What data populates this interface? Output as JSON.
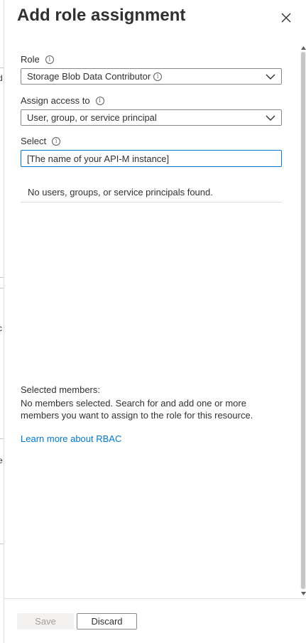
{
  "blade": {
    "title": "Add role assignment",
    "close_icon": "close-icon"
  },
  "form": {
    "role": {
      "label": "Role",
      "value": "Storage Blob Data Contributor",
      "info_icon": "info-icon",
      "value_info_icon": "info-icon",
      "chevron_icon": "chevron-down-icon"
    },
    "assign_access": {
      "label": "Assign access to",
      "value": "User, group, or service principal",
      "info_icon": "info-icon",
      "chevron_icon": "chevron-down-icon"
    },
    "select": {
      "label": "Select",
      "value": "[The name of your API-M instance]",
      "info_icon": "info-icon"
    },
    "results_empty_text": "No users, groups, or service principals found."
  },
  "selected_members": {
    "heading": "Selected members:",
    "description": "No members selected. Search for and add one or more members you want to assign to the role for this resource."
  },
  "learn_more_link": "Learn more about RBAC",
  "footer": {
    "save_label": "Save",
    "discard_label": "Discard"
  },
  "colors": {
    "accent": "#0078d4",
    "text": "#323130",
    "border": "#8a8886",
    "disabled_bg": "#f3f2f1",
    "disabled_text": "#a19f9d"
  }
}
